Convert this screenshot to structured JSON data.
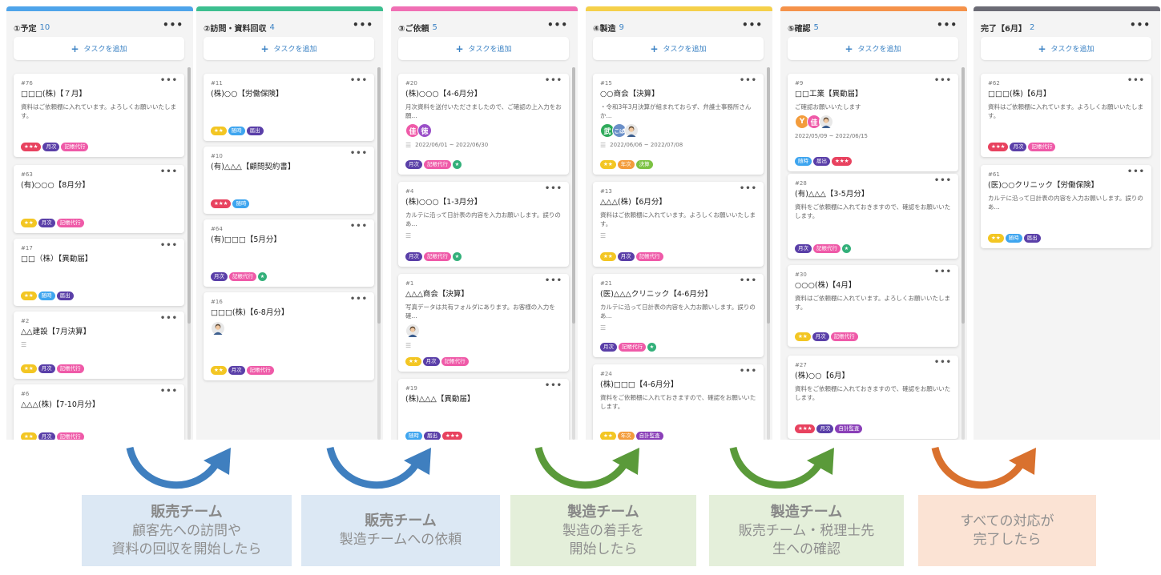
{
  "add_task_label": "タスクを追加",
  "columns": [
    {
      "title": "①予定",
      "count": "10",
      "color": "#4ea4ea",
      "cards": [
        {
          "id": "#76",
          "title": "□□□(株)【７月】",
          "desc": "資料はご依頼棚に入れています。よろしくお願いいたします。",
          "avatars": [],
          "date": "",
          "list": false,
          "tags": [
            "stars3",
            "getsuji",
            "kicho"
          ]
        },
        {
          "id": "#63",
          "title": "(有)○○○【8月分】",
          "desc": "",
          "avatars": [],
          "date": "",
          "list": false,
          "tags": [
            "stars2",
            "getsuji",
            "kicho"
          ]
        },
        {
          "id": "#17",
          "title": "□□（株）【異動届】",
          "desc": "",
          "avatars": [],
          "date": "",
          "list": false,
          "tags": [
            "stars2",
            "zuiji",
            "todokede"
          ]
        },
        {
          "id": "#2",
          "title": "△△建設【7月決算】",
          "desc": "",
          "avatars": [],
          "date": "",
          "list": true,
          "tags": [
            "stars2",
            "getsuji",
            "kicho"
          ]
        },
        {
          "id": "#6",
          "title": "△△△(株)【7-10月分】",
          "desc": "",
          "avatars": [],
          "date": "",
          "list": false,
          "tags": [
            "stars2",
            "getsuji",
            "kicho"
          ]
        }
      ]
    },
    {
      "title": "②訪問・資料回収",
      "count": "4",
      "color": "#3cbf8f",
      "cards": [
        {
          "id": "#11",
          "title": "(株)○○【労働保険】",
          "desc": "",
          "avatars": [],
          "date": "",
          "list": false,
          "tags": [
            "stars2",
            "zuiji",
            "todokede"
          ]
        },
        {
          "id": "#10",
          "title": "(有)△△△【顧問契約書】",
          "desc": "",
          "avatars": [],
          "date": "",
          "list": false,
          "tags": [
            "stars3",
            "zuiji"
          ]
        },
        {
          "id": "#64",
          "title": "(有)□□□【5月分】",
          "desc": "",
          "avatars": [],
          "date": "",
          "list": false,
          "tags": [
            "getsuji",
            "kicho",
            "check"
          ]
        },
        {
          "id": "#16",
          "title": "□□□(株)【6-8月分】",
          "desc": "",
          "avatars": [
            "photo"
          ],
          "date": "",
          "list": false,
          "tags": [
            "stars2",
            "getsuji",
            "kicho"
          ]
        }
      ]
    },
    {
      "title": "③ご依頼",
      "count": "5",
      "color": "#f06fb4",
      "cards": [
        {
          "id": "#20",
          "title": "(株)○○○【4-6月分】",
          "desc": "月次資料を送付いたださましたので、ご確認の上入力をお願...",
          "avatars": [
            "佳",
            "徳"
          ],
          "date": "2022/06/01 ~ 2022/06/30",
          "list": true,
          "tags": [
            "getsuji",
            "kicho",
            "check"
          ]
        },
        {
          "id": "#4",
          "title": "(株)○○○【1-3月分】",
          "desc": "カルテに沿って日計表の内容を入力お願いします。誤りのあ...",
          "avatars": [],
          "date": "",
          "list": true,
          "tags": [
            "getsuji",
            "kicho",
            "check"
          ]
        },
        {
          "id": "#1",
          "title": "△△△商会【決算】",
          "desc": "写真データは共有フォルダにあります。お客様の入力を確...",
          "avatars": [
            "photo"
          ],
          "date": "",
          "list": true,
          "tags": [
            "stars2",
            "getsuji",
            "kicho"
          ]
        },
        {
          "id": "#19",
          "title": "(株)△△△【異動届】",
          "desc": "",
          "avatars": [],
          "date": "",
          "list": false,
          "tags": [
            "zuiji",
            "todokede",
            "stars3"
          ]
        }
      ]
    },
    {
      "title": "④製造",
      "count": "9",
      "color": "#f5d04a",
      "cards": [
        {
          "id": "#15",
          "title": "○○商会【決算】",
          "desc": "・令和3年3月決算が組まれておらず、弁護士事務所さんか...",
          "avatars": [
            "武",
            "こば",
            "photo"
          ],
          "date": "2022/06/06 ~ 2022/07/08",
          "list": true,
          "tags": [
            "stars2",
            "nenji",
            "kessan"
          ]
        },
        {
          "id": "#13",
          "title": "△△△(株)【6月分】",
          "desc": "資料はご依頼棚に入れています。よろしくお願いいたします。",
          "avatars": [],
          "date": "",
          "list": true,
          "tags": [
            "stars2",
            "getsuji",
            "kicho"
          ]
        },
        {
          "id": "#21",
          "title": "(医)△△△クリニック【4-6月分】",
          "desc": "カルテに沿って日計表の内容を入力お願いします。誤りのあ...",
          "avatars": [],
          "date": "",
          "list": true,
          "tags": [
            "getsuji",
            "kicho",
            "check"
          ]
        },
        {
          "id": "#24",
          "title": "(株)□□□【4-6月分】",
          "desc": "資料をご依頼棚に入れておきますので、確認をお願いいたします。",
          "avatars": [],
          "date": "",
          "list": false,
          "tags": [
            "stars2",
            "nenji",
            "jikei"
          ]
        }
      ]
    },
    {
      "title": "⑤確認",
      "count": "5",
      "color": "#f5924a",
      "cards": [
        {
          "id": "#9",
          "title": "□□工業【異動届】",
          "desc": "ご確認お願いいたします",
          "avatars": [
            "Y",
            "佳",
            "photo"
          ],
          "date": "2022/05/09 ~ 2022/06/15",
          "list": false,
          "tags": [
            "zuiji",
            "todokede",
            "stars3"
          ]
        },
        {
          "id": "#28",
          "title": "(有)△△△【3-5月分】",
          "desc": "資料をご依頼棚に入れておきますので、確認をお願いいたします。",
          "avatars": [],
          "date": "",
          "list": false,
          "tags": [
            "getsuji",
            "kicho",
            "check"
          ]
        },
        {
          "id": "#30",
          "title": "○○○(株)【4月】",
          "desc": "資料はご依頼棚に入れています。よろしくお願いいたします。",
          "avatars": [],
          "date": "",
          "list": false,
          "tags": [
            "stars2",
            "getsuji",
            "kicho"
          ]
        },
        {
          "id": "#27",
          "title": "(株)○○【6月】",
          "desc": "資料をご依頼棚に入れておきますので、確認をお願いいたします。",
          "avatars": [],
          "date": "",
          "list": false,
          "tags": [
            "stars3",
            "getsuji",
            "jikei"
          ]
        }
      ]
    },
    {
      "title": "完了【6月】",
      "count": "2",
      "color": "#6b6b75",
      "cards": [
        {
          "id": "#62",
          "title": "□□□(株)【6月】",
          "desc": "資料はご依頼棚に入れています。よろしくお願いいたします。",
          "avatars": [],
          "date": "",
          "list": false,
          "tags": [
            "stars3",
            "getsuji",
            "kicho"
          ]
        },
        {
          "id": "#61",
          "title": "(医)○○クリニック【労働保険】",
          "desc": "カルテに沿って日計表の内容を入力お願いします。誤りのあ...",
          "avatars": [],
          "date": "",
          "list": false,
          "tags": [
            "stars2",
            "zuiji",
            "todokede"
          ]
        }
      ]
    }
  ],
  "tag_types": {
    "stars3": {
      "label": "★★★",
      "color": "#e8425f"
    },
    "stars2": {
      "label": "★★",
      "color": "#f3c623"
    },
    "getsuji": {
      "label": "月次",
      "color": "#5a3fa8"
    },
    "kicho": {
      "label": "記帳代行",
      "color": "#ef5aa8"
    },
    "zuiji": {
      "label": "随時",
      "color": "#3ea5ef"
    },
    "todokede": {
      "label": "届出",
      "color": "#5a3fa8"
    },
    "nenji": {
      "label": "年次",
      "color": "#f39c3c"
    },
    "kessan": {
      "label": "決算",
      "color": "#7cc243"
    },
    "jikei": {
      "label": "自計監査",
      "color": "#8a3fb8"
    },
    "check": {
      "label": "★",
      "color": "#33b07a"
    }
  },
  "avatar_colors": {
    "佳": "#ef5aa8",
    "徳": "#9a4fc8",
    "武": "#2eaa5a",
    "こば": "#6a8fc8",
    "Y": "#f39c3c"
  },
  "flow_labels": [
    {
      "title": "販売チーム",
      "lines": [
        "顧客先への訪問や",
        "資料の回収を開始したら"
      ],
      "bg": "#dce8f4",
      "arrow": "#3f7fbf"
    },
    {
      "title": "販売チーム",
      "lines": [
        "製造チームへの依頼"
      ],
      "bg": "#dce8f4",
      "arrow": "#3f7fbf"
    },
    {
      "title": "製造チーム",
      "lines": [
        "製造の着手を",
        "開始したら"
      ],
      "bg": "#e4efda",
      "arrow": "#5a9a3a"
    },
    {
      "title": "製造チーム",
      "lines": [
        "販売チーム・税理士先",
        "生への確認"
      ],
      "bg": "#e4efda",
      "arrow": "#5a9a3a"
    },
    {
      "title": "",
      "lines": [
        "すべての対応が",
        "完了したら"
      ],
      "bg": "#fbe3d4",
      "arrow": "#d9712e"
    }
  ]
}
